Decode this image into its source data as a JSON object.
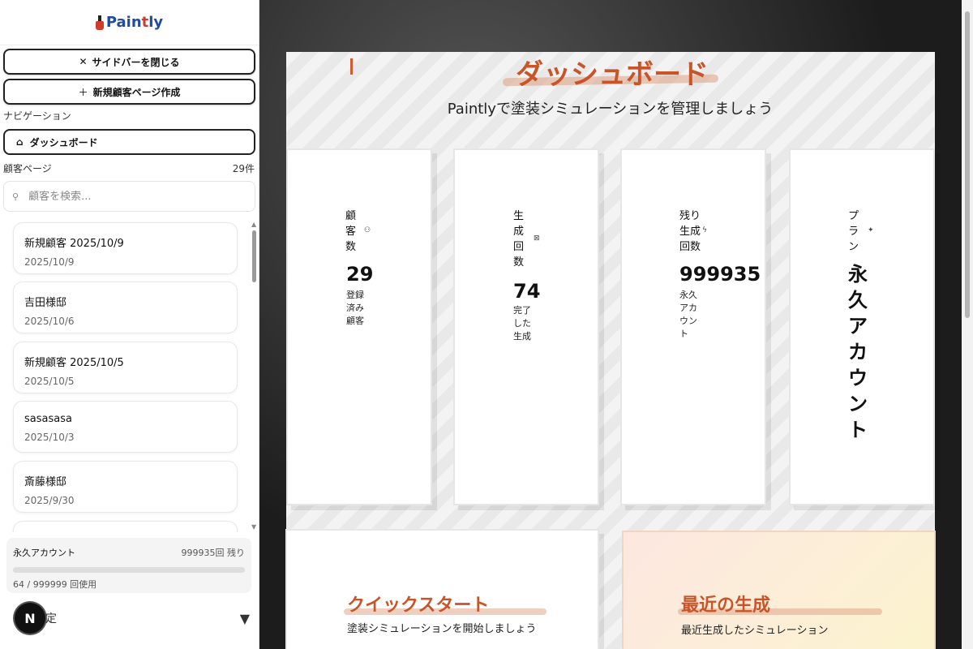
{
  "app": {
    "logo_text_1": "Pain",
    "logo_text_2": "t",
    "logo_text_3": "ly"
  },
  "sidebar": {
    "close_label": "サイドバーを閉じる",
    "new_customer_label": "新規顧客ページ作成",
    "nav_heading": "ナビゲーション",
    "nav_dashboard": "ダッシュボード",
    "customers_heading": "顧客ページ",
    "customers_count": "29件",
    "search_placeholder": "顧客を検索...",
    "customers": [
      {
        "name": "新規顧客 2025/10/9",
        "date": "2025/10/9"
      },
      {
        "name": "吉田様邸",
        "date": "2025/10/6"
      },
      {
        "name": "新規顧客 2025/10/5",
        "date": "2025/10/5"
      },
      {
        "name": "sasasasa",
        "date": "2025/10/3"
      },
      {
        "name": "斎藤様邸",
        "date": "2025/9/30"
      }
    ],
    "plan": {
      "title": "永久アカウント",
      "remaining": "999935回 残り",
      "usage": "64 / 999999 回使用",
      "used_fraction": 6.4e-05
    },
    "settings_label": "設定",
    "badge": "N"
  },
  "main": {
    "title": "ダッシュボード",
    "subtitle": "Paintlyで塗装シミュレーションを管理しましょう",
    "stats": [
      {
        "label": "顧客数",
        "value": "29",
        "desc": "登録済み顧客",
        "icon": "users-icon"
      },
      {
        "label": "生成回数",
        "value": "74",
        "desc": "完了した生成",
        "icon": "image-icon"
      },
      {
        "label": "残り生成回数",
        "value": "999935",
        "desc": "永久アカウント",
        "icon": "bolt-icon"
      },
      {
        "label": "プラン",
        "value": "永久アカウント",
        "icon": "sparkle-icon"
      }
    ],
    "quickstart_title": "クイックスタート",
    "quickstart_sub": "塗装シミュレーションを開始しましょう",
    "recent_title": "最近の生成",
    "recent_sub": "最近生成したシミュレーション"
  }
}
